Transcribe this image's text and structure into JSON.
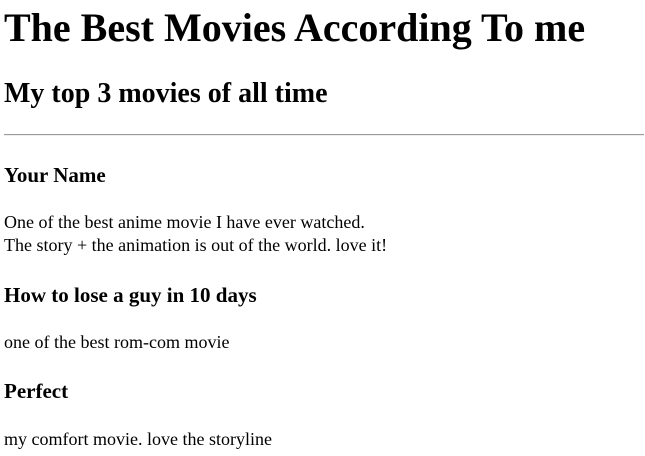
{
  "page": {
    "title": "The Best Movies According To me",
    "subtitle": "My top 3 movies of all time"
  },
  "movies": [
    {
      "title": "Your Name",
      "description_line1": "One of the best anime movie I have ever watched.",
      "description_line2": "The story + the animation is out of the world. love it!"
    },
    {
      "title": "How to lose a guy in 10 days",
      "description_line1": "one of the best rom-com movie"
    },
    {
      "title": "Perfect",
      "description_line1": "my comfort movie. love the storyline"
    }
  ]
}
